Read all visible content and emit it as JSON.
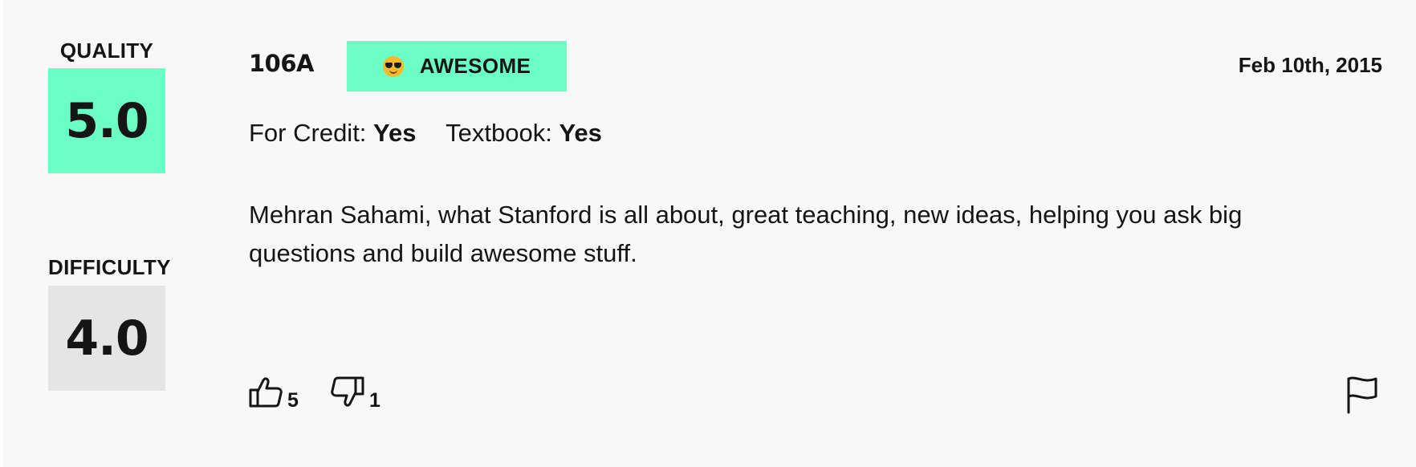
{
  "ratings": {
    "quality": {
      "label": "QUALITY",
      "value": "5.0",
      "color": "#6bffc5"
    },
    "difficulty": {
      "label": "DIFFICULTY",
      "value": "4.0",
      "color": "#e5e5e5"
    }
  },
  "review": {
    "course": "106A",
    "tag": {
      "emoji_icon": "sunglasses-emoji-icon",
      "label": "AWESOME",
      "color": "#6bffc5"
    },
    "date": "Feb 10th, 2015",
    "meta": [
      {
        "label": "For Credit:",
        "value": "Yes"
      },
      {
        "label": "Textbook:",
        "value": "Yes"
      }
    ],
    "comment": "Mehran Sahami, what Stanford is all about, great teaching, new ideas, helping you ask big questions and build awesome stuff."
  },
  "votes": {
    "up": {
      "icon": "thumbs-up-icon",
      "count": "5"
    },
    "down": {
      "icon": "thumbs-down-icon",
      "count": "1"
    },
    "report_icon": "flag-icon"
  }
}
